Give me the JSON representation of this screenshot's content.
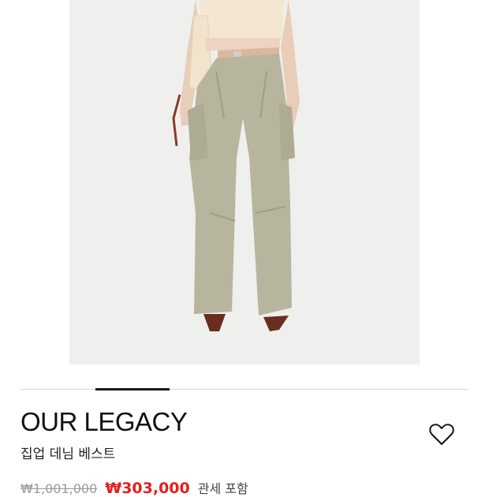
{
  "product": {
    "image_alt": "model wearing beige cargo pants",
    "brand": "OUR LEGACY",
    "name": "집업 데님 베스트",
    "original_price": "₩1,001,000",
    "sale_price": "₩303,000",
    "tax_note": "관세 포함"
  },
  "gallery": {
    "current_index": 2,
    "total": 6
  },
  "colors": {
    "sale": "#e0201f",
    "photo_background": "#efefee",
    "pants": "#b8b59e"
  },
  "icons": {
    "wishlist": "heart-outline-icon"
  }
}
